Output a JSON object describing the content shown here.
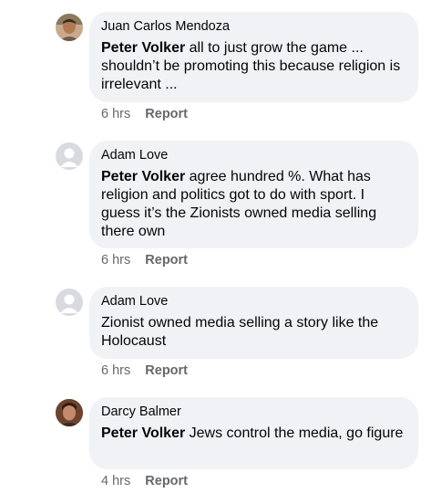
{
  "comments": [
    {
      "author": "Juan Carlos Mendoza",
      "mention": "Peter Volker",
      "text": " all to just grow the game ... shouldn’t be promoting this because religion is irrelevant ...",
      "time": "6 hrs",
      "action": "Report",
      "avatar": "photo-avatar-icon"
    },
    {
      "author": "Adam Love",
      "mention": "Peter Volker",
      "text": " agree hundred %. What has religion and politics got to do with sport. I guess it’s the Zionists owned media selling there own",
      "time": "6 hrs",
      "action": "Report",
      "avatar": "default-avatar-icon"
    },
    {
      "author": "Adam Love",
      "mention": "",
      "text": "Zionist owned media selling a story like the Holocaust",
      "time": "6 hrs",
      "action": "Report",
      "avatar": "default-avatar-icon"
    },
    {
      "author": "Darcy Balmer",
      "mention": "Peter Volker",
      "text": " Jews control the media, go figure",
      "time": "4 hrs",
      "action": "Report",
      "avatar": "photo-avatar-icon"
    }
  ],
  "colors": {
    "bubble": "#f0f2f5",
    "meta": "#65676b",
    "text": "#050505"
  }
}
